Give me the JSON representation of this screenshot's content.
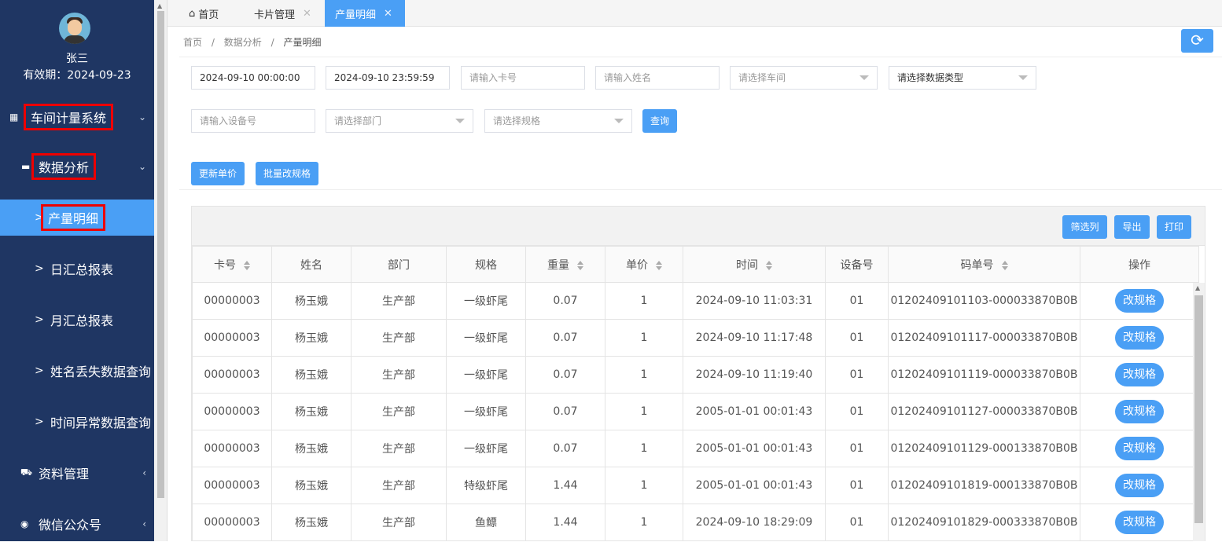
{
  "user": {
    "name": "张三",
    "expiry": "有效期：2024-09-23"
  },
  "menu": [
    {
      "label": "车间计量系统",
      "icon": "grid-icon",
      "chevron": "⌄"
    },
    {
      "label": "数据分析",
      "icon": "monitor-icon",
      "chevron": "⌄"
    },
    {
      "label": "产量明细",
      "prefix": ">"
    },
    {
      "label": "日汇总报表",
      "prefix": ">"
    },
    {
      "label": "月汇总报表",
      "prefix": ">"
    },
    {
      "label": "姓名丢失数据查询",
      "prefix": ">"
    },
    {
      "label": "时间异常数据查询",
      "prefix": ">"
    },
    {
      "label": "资料管理",
      "icon": "car-icon",
      "chevron": "‹"
    },
    {
      "label": "微信公众号",
      "icon": "wechat-icon",
      "chevron": "‹"
    }
  ],
  "tabs": [
    {
      "label": "首页",
      "icon": "home-icon"
    },
    {
      "label": "卡片管理",
      "close": "✕"
    },
    {
      "label": "产量明细",
      "close": "✕"
    }
  ],
  "breadcrumb": {
    "items": [
      "首页",
      "/",
      "数据分析",
      "/",
      "产量明细"
    ]
  },
  "filters": {
    "start_time": "2024-09-10 00:00:00",
    "end_time": "2024-09-10 23:59:59",
    "card_placeholder": "请输入卡号",
    "name_placeholder": "请输入姓名",
    "workshop_placeholder": "请选择车间",
    "datatype_placeholder": "请选择数据类型",
    "device_placeholder": "请输入设备号",
    "dept_placeholder": "请选择部门",
    "spec_placeholder": "请选择规格",
    "query_label": "查询"
  },
  "actions": {
    "update_price": "更新单价",
    "batch_spec": "批量改规格"
  },
  "toolbar": {
    "filter_cols": "筛选列",
    "export": "导出",
    "print": "打印"
  },
  "table": {
    "headers": [
      "卡号",
      "姓名",
      "部门",
      "规格",
      "重量",
      "单价",
      "时间",
      "设备号",
      "码单号",
      "操作"
    ],
    "action_label": "改规格",
    "rows": [
      [
        "00000003",
        "杨玉娥",
        "生产部",
        "一级虾尾",
        "0.07",
        "1",
        "2024-09-10 11:03:31",
        "01",
        "01202409101103-000033870B0B"
      ],
      [
        "00000003",
        "杨玉娥",
        "生产部",
        "一级虾尾",
        "0.07",
        "1",
        "2024-09-10 11:17:48",
        "01",
        "01202409101117-000033870B0B"
      ],
      [
        "00000003",
        "杨玉娥",
        "生产部",
        "一级虾尾",
        "0.07",
        "1",
        "2024-09-10 11:19:40",
        "01",
        "01202409101119-000033870B0B"
      ],
      [
        "00000003",
        "杨玉娥",
        "生产部",
        "一级虾尾",
        "0.07",
        "1",
        "2005-01-01 00:01:43",
        "01",
        "01202409101127-000033870B0B"
      ],
      [
        "00000003",
        "杨玉娥",
        "生产部",
        "一级虾尾",
        "0.07",
        "1",
        "2005-01-01 00:01:43",
        "01",
        "01202409101129-000133870B0B"
      ],
      [
        "00000003",
        "杨玉娥",
        "生产部",
        "特级虾尾",
        "1.44",
        "1",
        "2005-01-01 00:01:43",
        "01",
        "01202409101819-000133870B0B"
      ],
      [
        "00000003",
        "杨玉娥",
        "生产部",
        "鱼鳔",
        "1.44",
        "1",
        "2024-09-10 18:29:09",
        "01",
        "01202409101829-000333870B0B"
      ]
    ]
  },
  "colors": {
    "sidebar": "#1f3663",
    "accent": "#4a9ff5",
    "highlight_box": "#e00000"
  }
}
